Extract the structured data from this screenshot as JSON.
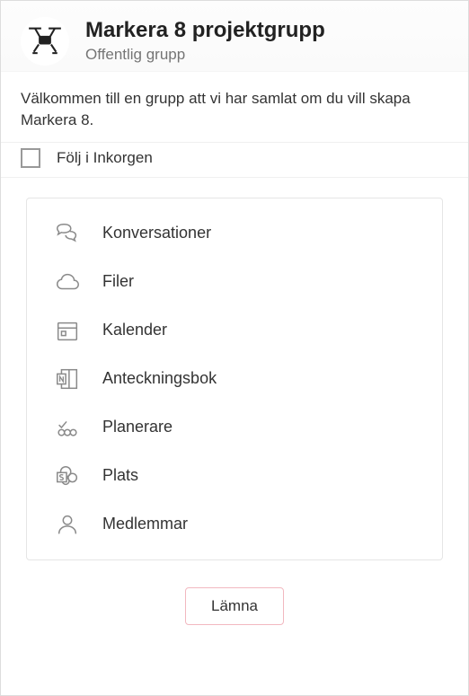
{
  "header": {
    "title": "Markera 8 projektgrupp",
    "subtitle": "Offentlig grupp"
  },
  "description": "Välkommen till en grupp att vi har samlat om du vill skapa Markera 8.",
  "follow": {
    "label": "Följ i Inkorgen",
    "checked": false
  },
  "nav": {
    "items": [
      {
        "label": "Konversationer"
      },
      {
        "label": "Filer"
      },
      {
        "label": "Kalender"
      },
      {
        "label": "Anteckningsbok"
      },
      {
        "label": "Planerare"
      },
      {
        "label": "Plats"
      },
      {
        "label": "Medlemmar"
      }
    ]
  },
  "footer": {
    "leave_label": "Lämna"
  }
}
